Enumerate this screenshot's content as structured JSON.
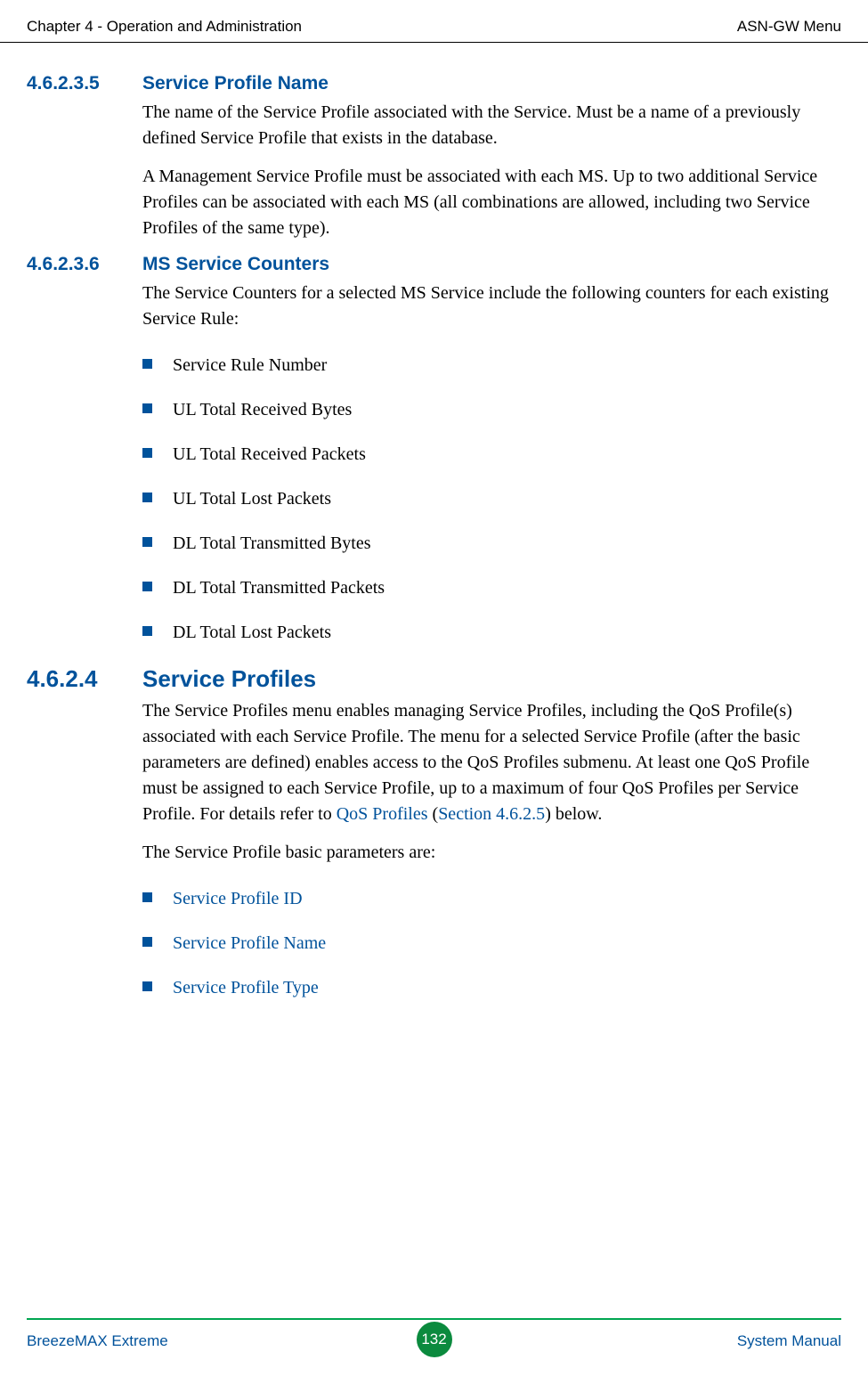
{
  "header": {
    "left": "Chapter 4 - Operation and Administration",
    "right": "ASN-GW Menu"
  },
  "sections": [
    {
      "num": "4.6.2.3.5",
      "level": 5,
      "title": "Service Profile Name",
      "paras": [
        "The name of the Service Profile associated with the Service. Must be a name of a previously defined Service Profile that exists in the database.",
        "A Management Service Profile must be associated with each MS. Up to two additional Service Profiles can be associated with each MS (all combinations are allowed, including two Service Profiles of the same type)."
      ]
    },
    {
      "num": "4.6.2.3.6",
      "level": 5,
      "title": "MS Service Counters",
      "paras": [
        "The Service Counters for a selected MS Service include the following counters for each existing Service Rule:"
      ],
      "bullets": [
        "Service Rule Number",
        "UL Total Received Bytes",
        "UL Total Received Packets",
        "UL Total Lost Packets",
        "DL Total Transmitted Bytes",
        "DL Total Transmitted Packets",
        "DL Total Lost Packets"
      ]
    },
    {
      "num": "4.6.2.4",
      "level": 4,
      "title": "Service Profiles",
      "paras_rich": [
        {
          "parts": [
            {
              "t": "The Service Profiles menu enables managing Service Profiles, including the QoS Profile(s) associated with each Service Profile. The menu for a selected Service Profile (after the basic parameters are defined) enables access to the QoS Profiles submenu. At least one QoS Profile must be assigned to each Service Profile, up to a maximum of four QoS Profiles per Service Profile. For details refer to "
            },
            {
              "t": "QoS Profiles",
              "link": true
            },
            {
              "t": " ("
            },
            {
              "t": "Section 4.6.2.5",
              "link": true
            },
            {
              "t": ") below."
            }
          ]
        },
        {
          "parts": [
            {
              "t": "The Service Profile basic parameters are:"
            }
          ]
        }
      ],
      "link_bullets": [
        "Service Profile ID",
        "Service Profile Name",
        "Service Profile Type"
      ]
    }
  ],
  "footer": {
    "left": "BreezeMAX Extreme",
    "page": "132",
    "right": "System Manual"
  }
}
